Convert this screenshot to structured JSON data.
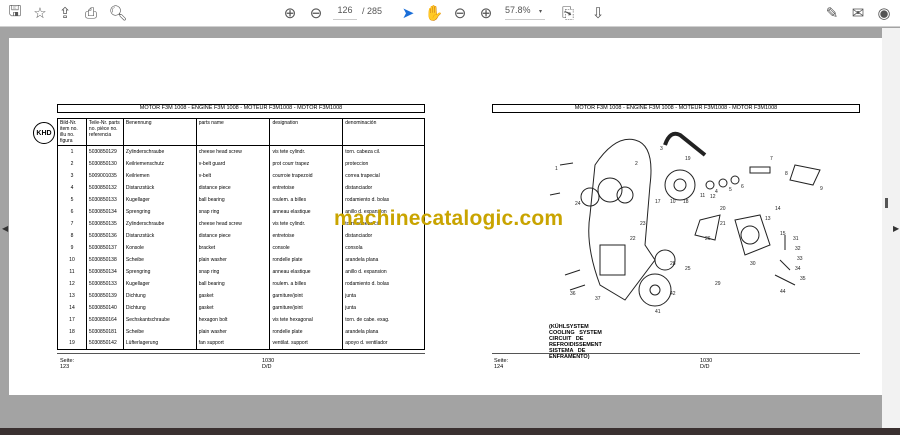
{
  "toolbar": {
    "page_current": "126",
    "page_total": "/ 285",
    "zoom": "57.8%"
  },
  "left_page": {
    "title": "MOTOR F3M 1008 - ENGINE F3M 1008 - MOTEUR F3M1008 - MOTOR F3M1008",
    "logo_text": "KHD",
    "headers": [
      "Bild-Nr. item no. illu no. figura",
      "Teile-Nr. parts no. pièce no. referencia",
      "Benennung",
      "parts name",
      "designation",
      "denominación"
    ],
    "rows": [
      [
        "1",
        "5030850129",
        "Zylinderschraube",
        "cheese head screw",
        "vis tete cylindr.",
        "torn. cabeza cil."
      ],
      [
        "2",
        "5030850130",
        "Keilriemenschutz",
        "v-belt guard",
        "prot courr trapez",
        "proteccion"
      ],
      [
        "3",
        "5009001035",
        "Keilriemen",
        "v-belt",
        "courroie trapezoid",
        "correa trapecial"
      ],
      [
        "4",
        "5030850132",
        "Distanzstück",
        "distance piece",
        "entretoise",
        "distanciador"
      ],
      [
        "5",
        "5030850133",
        "Kugellager",
        "ball bearing",
        "roulem. a billes",
        "rodamiento d. bolas"
      ],
      [
        "6",
        "5030850134",
        "Sprengring",
        "snap ring",
        "anneau elastique",
        "anillo d. expansion"
      ],
      [
        "7",
        "5030850135",
        "Zylinderschraube",
        "cheese head screw",
        "vis tete cylindr.",
        "torn. cabeza cil."
      ],
      [
        "8",
        "5030850136",
        "Distanzstück",
        "distance piece",
        "entretoise",
        "distanciador"
      ],
      [
        "9",
        "5030850137",
        "Konsole",
        "bracket",
        "console",
        "consola"
      ],
      [
        "10",
        "5030850138",
        "Scheibe",
        "plain washer",
        "rondelle plate",
        "arandela plana"
      ],
      [
        "11",
        "5030850134",
        "Sprengring",
        "snap ring",
        "anneau elastique",
        "anillo d. expansion"
      ],
      [
        "12",
        "5030850133",
        "Kugellager",
        "ball bearing",
        "roulem. a billes",
        "rodamiento d. bolas"
      ],
      [
        "13",
        "5030850139",
        "Dichtung",
        "gasket",
        "garniture/joint",
        "junta"
      ],
      [
        "14",
        "5030850140",
        "Dichtung",
        "gasket",
        "garniture/joint",
        "junta"
      ],
      [
        "17",
        "5030850164",
        "Sechskantschraube",
        "hexagon bolt",
        "vis tete hexagonal",
        "torn. de cabe. exag."
      ],
      [
        "18",
        "5030850181",
        "Scheibe",
        "plain washer",
        "rondelle plate",
        "arandela plana"
      ],
      [
        "19",
        "5030850142",
        "Lüfterlagerung",
        "fan support",
        "ventilat. support",
        "apoyo d. ventilador"
      ]
    ],
    "footer_page": "Seite: 123",
    "footer_code": "1030 D/D"
  },
  "right_page": {
    "title": "MOTOR F3M 1008 - ENGINE F3M 1008 - MOTEUR F3M1008 - MOTOR F3M1008",
    "caption": "(KÜHLSYSTEM   COOLING SYSTEM   CIRCUIT DE REFROIDISSEMENT   SISTEMA DE ENFRAMENTO)",
    "labels": [
      "1",
      "2",
      "3",
      "19",
      "4",
      "5",
      "6",
      "7",
      "8",
      "9",
      "11",
      "12",
      "17",
      "10",
      "18",
      "20",
      "21",
      "13",
      "14",
      "15",
      "22",
      "23",
      "24",
      "25",
      "26",
      "30",
      "31",
      "32",
      "33",
      "34",
      "35",
      "36",
      "37",
      "29",
      "28",
      "41",
      "42",
      "44"
    ],
    "footer_page": "Seite: 124",
    "footer_code": "1030 D/D"
  },
  "watermark": "machinecatalogic.com"
}
